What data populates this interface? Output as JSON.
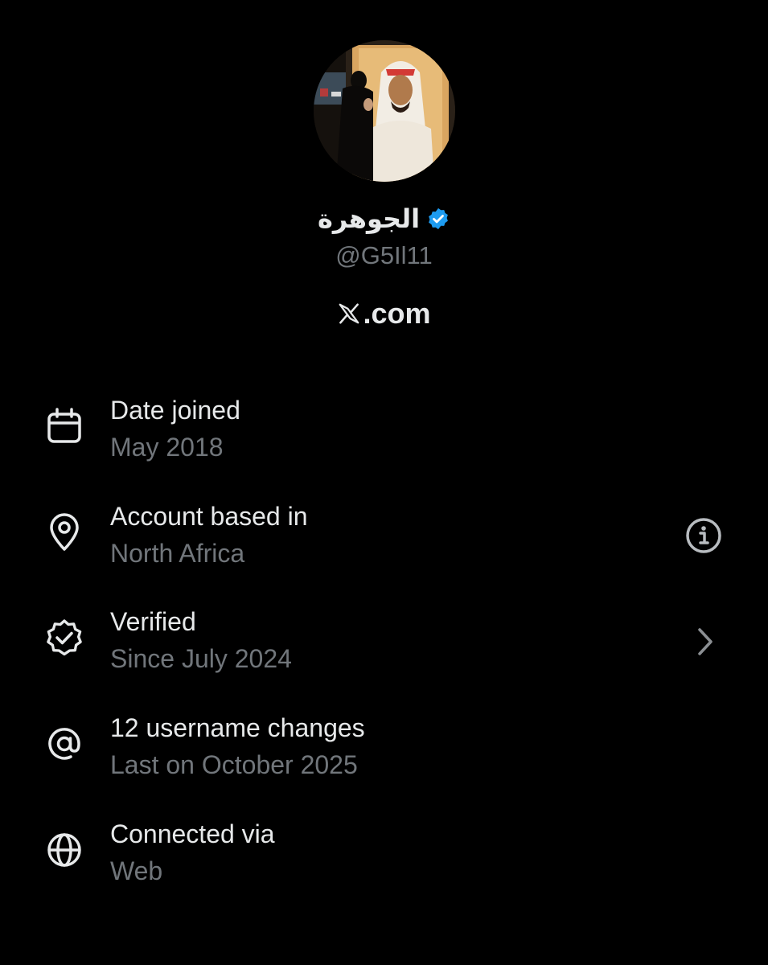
{
  "profile": {
    "display_name": "الجوهرة",
    "handle": "@G5Il11",
    "site": ".com",
    "site_icon": "x-logo-icon",
    "verified_badge_color": "#1d9bf0"
  },
  "colors": {
    "background": "#000000",
    "primary_text": "#e7e9ea",
    "secondary_text": "#71767b"
  },
  "rows": [
    {
      "title": "Date joined",
      "subtitle": "May 2018",
      "icon": "calendar-icon"
    },
    {
      "title": "Account based in",
      "subtitle": "North Africa",
      "icon": "location-pin-icon",
      "action_icon": "info-icon"
    },
    {
      "title": "Verified",
      "subtitle": "Since July 2024",
      "icon": "verified-badge-icon",
      "action_icon": "chevron-right-icon"
    },
    {
      "title": "12 username changes",
      "subtitle": "Last on October 2025",
      "icon": "at-sign-icon"
    },
    {
      "title": "Connected via",
      "subtitle": "Web",
      "icon": "globe-icon"
    }
  ]
}
